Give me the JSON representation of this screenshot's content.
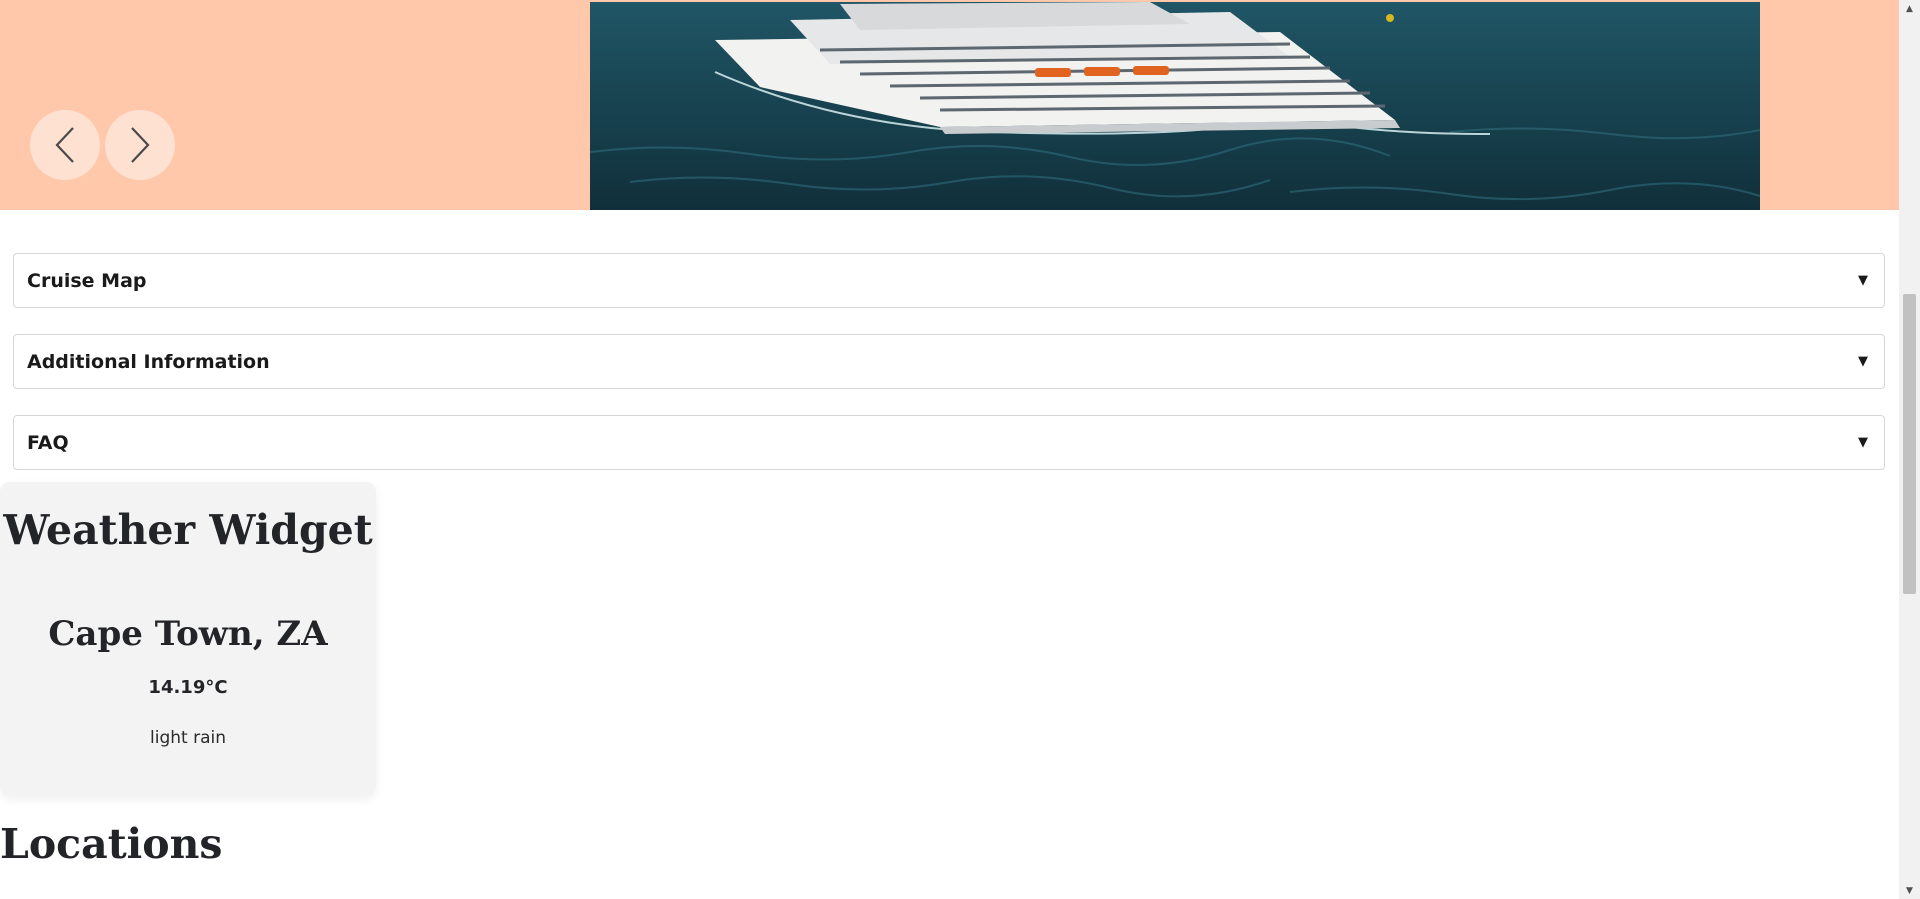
{
  "carousel": {
    "prev_icon": "chevron-left-icon",
    "next_icon": "chevron-right-icon",
    "background_color": "#ffc8ab"
  },
  "accordion": {
    "items": [
      {
        "label": "Cruise Map",
        "arrow": "▼"
      },
      {
        "label": "Additional Information",
        "arrow": "▼"
      },
      {
        "label": "FAQ",
        "arrow": "▼"
      }
    ]
  },
  "weather": {
    "title": "Weather Widget",
    "city": "Cape Town, ZA",
    "temperature": "14.19°C",
    "description": "light rain"
  },
  "sections": {
    "locations_heading": "Locations"
  },
  "scrollbar": {
    "up_arrow": "▲",
    "down_arrow": "▼"
  }
}
